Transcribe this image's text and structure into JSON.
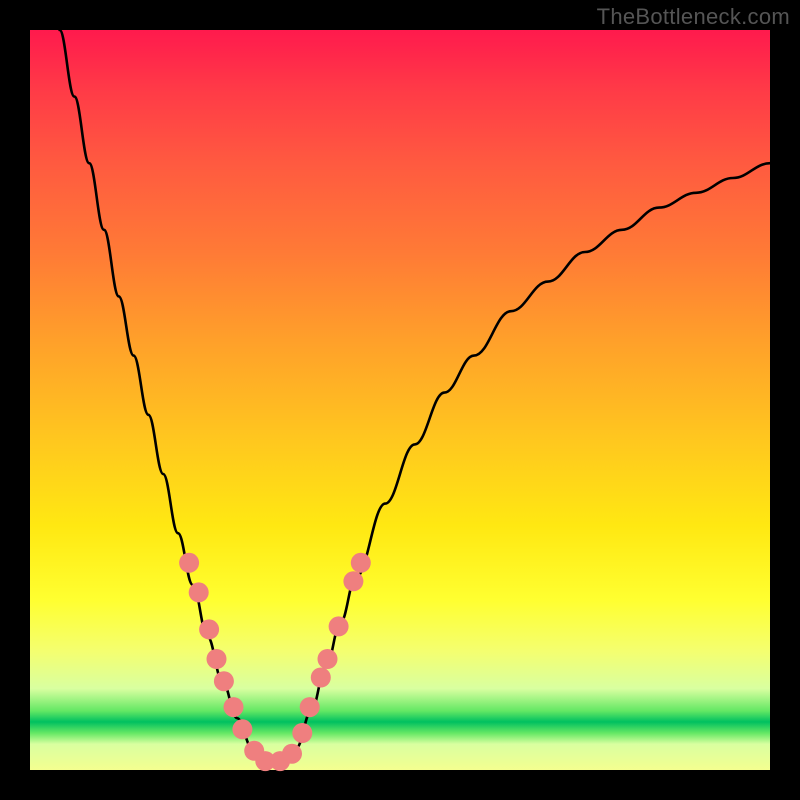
{
  "watermark": "TheBottleneck.com",
  "chart_data": {
    "type": "line",
    "title": "",
    "xlabel": "",
    "ylabel": "",
    "xlim": [
      0,
      100
    ],
    "ylim": [
      0,
      100
    ],
    "curve": {
      "name": "bottleneck-curve",
      "color": "#000000",
      "points": [
        {
          "x": 4,
          "y": 100
        },
        {
          "x": 6,
          "y": 91
        },
        {
          "x": 8,
          "y": 82
        },
        {
          "x": 10,
          "y": 73
        },
        {
          "x": 12,
          "y": 64
        },
        {
          "x": 14,
          "y": 56
        },
        {
          "x": 16,
          "y": 48
        },
        {
          "x": 18,
          "y": 40
        },
        {
          "x": 20,
          "y": 32
        },
        {
          "x": 22,
          "y": 25
        },
        {
          "x": 24,
          "y": 18
        },
        {
          "x": 26,
          "y": 12
        },
        {
          "x": 28,
          "y": 7
        },
        {
          "x": 30,
          "y": 3
        },
        {
          "x": 32,
          "y": 1
        },
        {
          "x": 34,
          "y": 1
        },
        {
          "x": 36,
          "y": 3
        },
        {
          "x": 38,
          "y": 8
        },
        {
          "x": 40,
          "y": 14
        },
        {
          "x": 42,
          "y": 20
        },
        {
          "x": 44,
          "y": 26
        },
        {
          "x": 48,
          "y": 36
        },
        {
          "x": 52,
          "y": 44
        },
        {
          "x": 56,
          "y": 51
        },
        {
          "x": 60,
          "y": 56
        },
        {
          "x": 65,
          "y": 62
        },
        {
          "x": 70,
          "y": 66
        },
        {
          "x": 75,
          "y": 70
        },
        {
          "x": 80,
          "y": 73
        },
        {
          "x": 85,
          "y": 76
        },
        {
          "x": 90,
          "y": 78
        },
        {
          "x": 95,
          "y": 80
        },
        {
          "x": 100,
          "y": 82
        }
      ]
    },
    "markers": {
      "name": "highlighted-points",
      "color": "#ef7f7f",
      "radius": 10,
      "points": [
        {
          "x": 21.5,
          "y": 28
        },
        {
          "x": 22.8,
          "y": 24
        },
        {
          "x": 24.2,
          "y": 19
        },
        {
          "x": 25.2,
          "y": 15
        },
        {
          "x": 26.2,
          "y": 12
        },
        {
          "x": 27.5,
          "y": 8.5
        },
        {
          "x": 28.7,
          "y": 5.5
        },
        {
          "x": 30.3,
          "y": 2.6
        },
        {
          "x": 31.8,
          "y": 1.2
        },
        {
          "x": 33.8,
          "y": 1.2
        },
        {
          "x": 35.4,
          "y": 2.2
        },
        {
          "x": 36.8,
          "y": 5
        },
        {
          "x": 37.8,
          "y": 8.5
        },
        {
          "x": 39.3,
          "y": 12.5
        },
        {
          "x": 40.2,
          "y": 15
        },
        {
          "x": 41.7,
          "y": 19.4
        },
        {
          "x": 43.7,
          "y": 25.5
        },
        {
          "x": 44.7,
          "y": 28
        }
      ]
    }
  }
}
